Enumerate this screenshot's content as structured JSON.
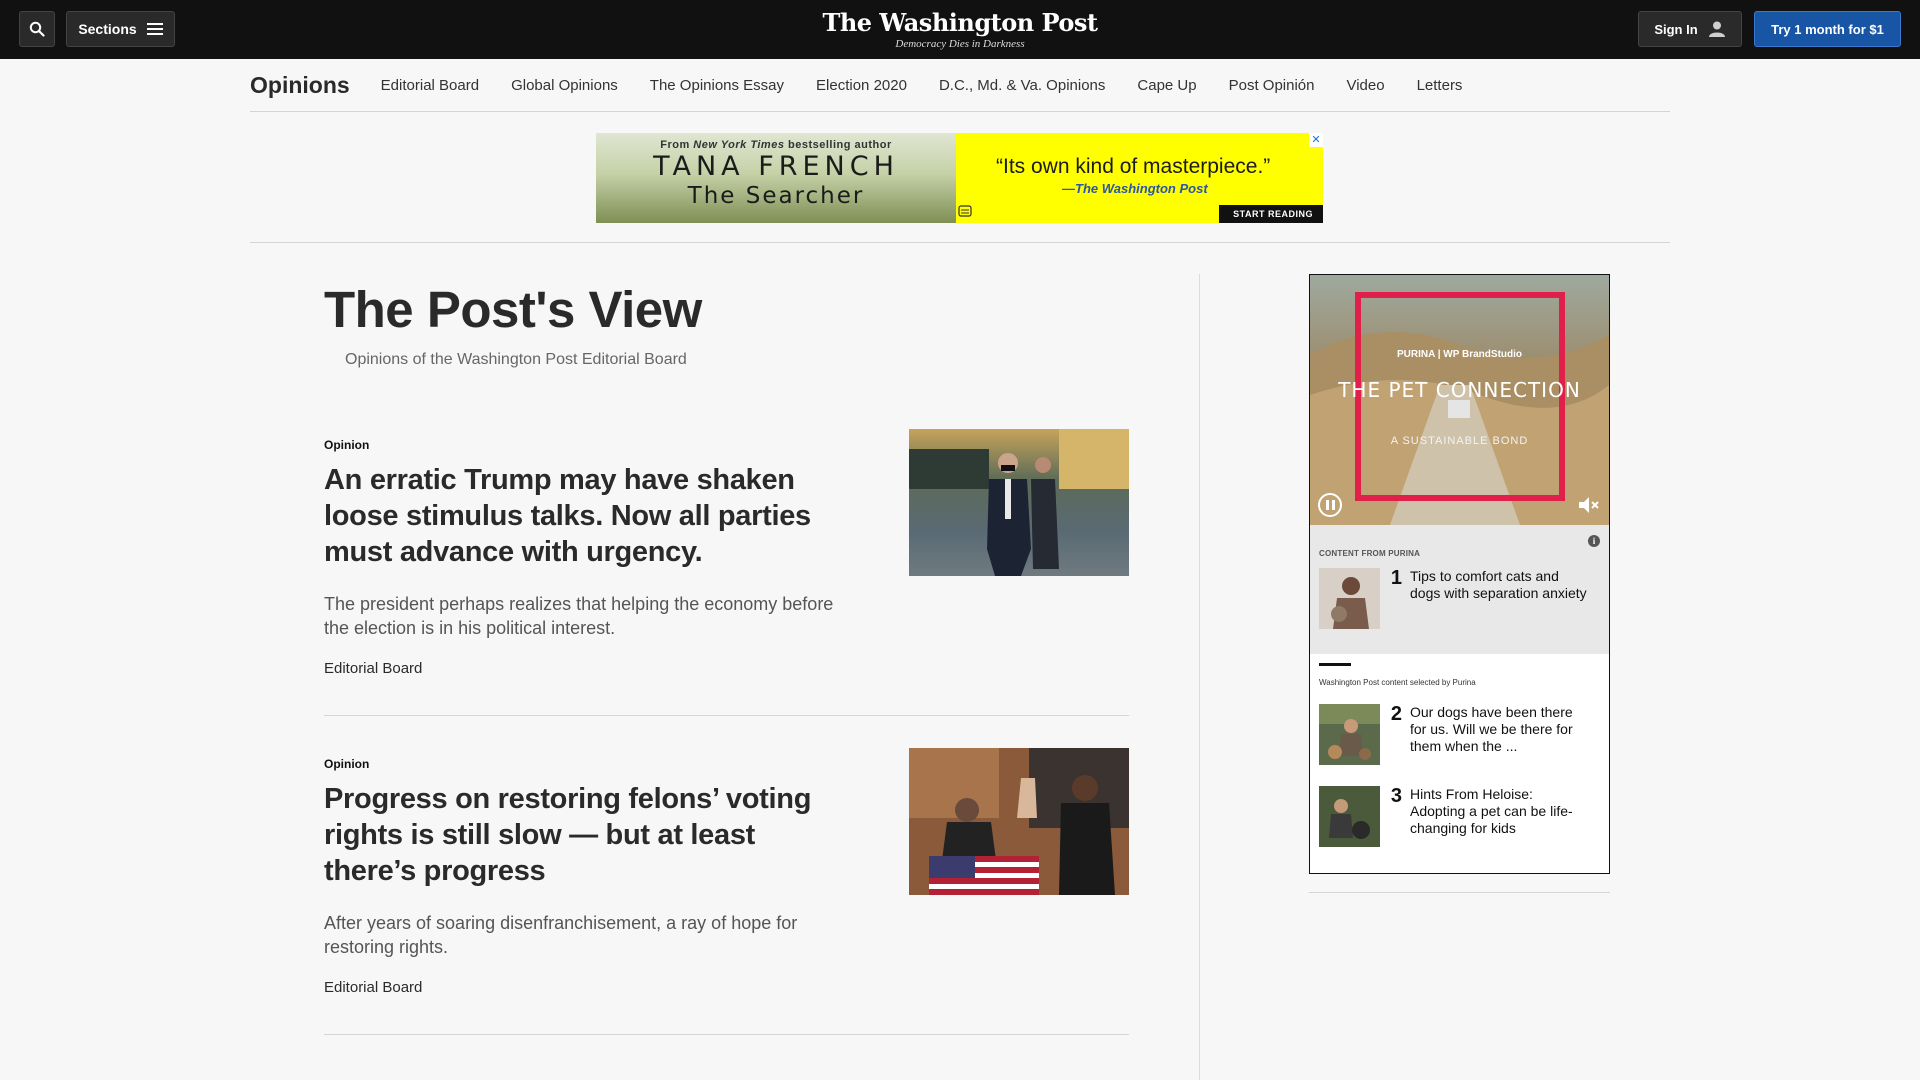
{
  "header": {
    "logo": "The Washington Post",
    "tagline": "Democracy Dies in Darkness",
    "sections_label": "Sections",
    "signin_label": "Sign In",
    "trial_label": "Try 1 month for $1",
    "icons": [
      "search-icon",
      "hamburger-icon",
      "user-icon"
    ]
  },
  "subnav": {
    "title": "Opinions",
    "items": [
      "Editorial Board",
      "Global Opinions",
      "The Opinions Essay",
      "Election 2020",
      "D.C., Md. & Va. Opinions",
      "Cape Up",
      "Post Opinión",
      "Video",
      "Letters"
    ]
  },
  "banner_ad": {
    "from_prefix": "From",
    "from_pub": "New York Times",
    "from_suffix": "bestselling author",
    "author": "TANA FRENCH",
    "book": "The Searcher",
    "quote": "“Its own kind of masterpiece.”",
    "quote_source": "—The Washington Post",
    "cta": "START READING",
    "close": "✕",
    "colors": {
      "left": "#c6d1a7",
      "right": "#ffff00"
    }
  },
  "page": {
    "title": "The Post's View",
    "subtitle": "Opinions of the Washington Post Editorial Board"
  },
  "stories": [
    {
      "kicker": "Opinion",
      "headline": "An erratic Trump may have shaken loose stimulus talks. Now all parties must advance with urgency.",
      "dek": "The president perhaps realizes that helping the economy before the election is in his political interest.",
      "byline": "Editorial Board"
    },
    {
      "kicker": "Opinion",
      "headline": "Progress on restoring felons’ voting rights is still slow — but at least there’s progress",
      "dek": "After years of soaring disenfranchisement, a ray of hope for restoring rights.",
      "byline": "Editorial Board"
    }
  ],
  "rail_ad": {
    "brand": "PURINA  |  WP BrandStudio",
    "title": "THE PET CONNECTION",
    "subtitle": "A SUSTAINABLE BOND",
    "content_label": "CONTENT FROM PURINA",
    "info": "i",
    "items": [
      {
        "num": "1",
        "text": "Tips to comfort cats and dogs with separation anxiety"
      },
      {
        "num": "2",
        "text": "Our dogs have been there for us. Will we be there for them when the ..."
      },
      {
        "num": "3",
        "text": "Hints From Heloise: Adopting a pet can be life-changing for kids"
      }
    ],
    "note": "Washington Post content selected by Purina",
    "accent": "#e0204a"
  }
}
